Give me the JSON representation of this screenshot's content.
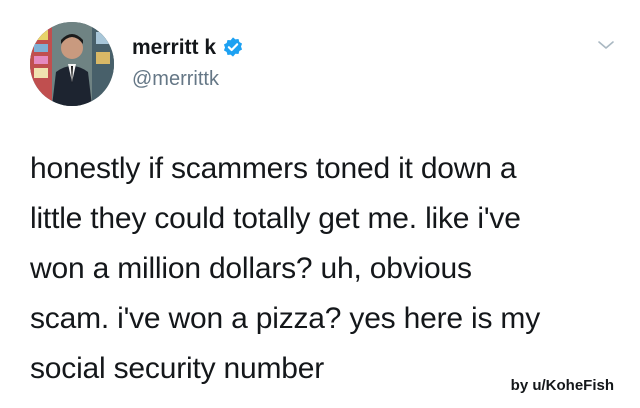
{
  "user": {
    "display_name": "merritt k",
    "handle": "@merrittk",
    "verified": true,
    "verified_color": "#1da1f2",
    "avatar_icon": "profile-photo"
  },
  "tweet": {
    "lines": [
      "honestly if scammers toned it down a",
      "little they could totally get me. like i've",
      "won a million dollars? uh, obvious",
      "scam. i've won a pizza? yes here is my",
      "social security number"
    ]
  },
  "menu_icon": "chevron-down-icon",
  "watermark": "by u/KoheFish"
}
